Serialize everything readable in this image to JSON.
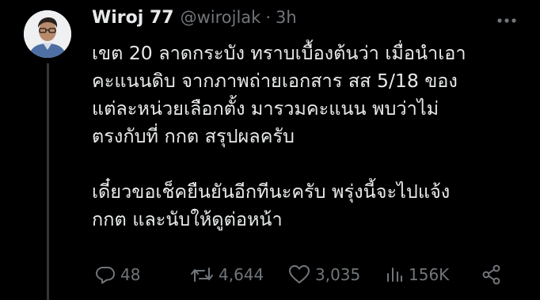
{
  "tweet": {
    "display_name": "Wiroj 77",
    "handle": "@wirojlak",
    "separator": "·",
    "time": "3h",
    "body_lines": [
      "เขต 20 ลาดกระบัง ทราบเบื้องต้นว่า เมื่อนำเอา",
      "คะแนนดิบ จากภาพถ่ายเอกสาร สส 5/18 ของ",
      "แต่ละหน่วยเลือกตั้ง มารวมคะแนน พบว่าไม่",
      "ตรงกับที่ กกต สรุปผลครับ",
      "",
      "เดี๋ยวขอเช็คยืนยันอีกทีนะครับ พรุ่งนี้จะไปแจ้ง",
      "กกต และนับให้ดูต่อหน้า"
    ],
    "stats": {
      "replies": "48",
      "retweets": "4,644",
      "likes": "3,035",
      "views": "156K"
    }
  },
  "icons": {
    "more": "more-dots-icon",
    "reply": "reply-icon",
    "retweet": "retweet-icon",
    "like": "heart-icon",
    "views": "views-bar-chart-icon",
    "share": "share-icon"
  },
  "colors": {
    "background": "#000000",
    "text": "#e7e9ea",
    "secondary": "#71767b",
    "thread_line": "#333639"
  }
}
